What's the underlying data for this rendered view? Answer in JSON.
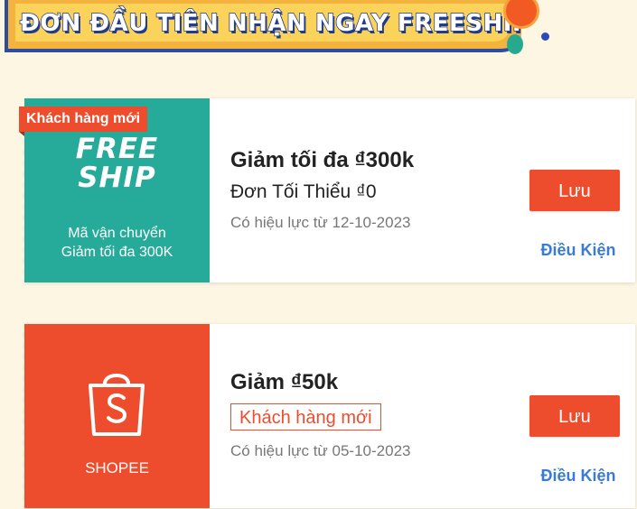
{
  "banner": {
    "title": "ĐƠN ĐẦU TIÊN NHẬN NGAY FREESHIP"
  },
  "vouchers": [
    {
      "type": "freeship",
      "badge": "Khách hàng mới",
      "logo_line1": "FREE",
      "logo_line2": "SHIP",
      "caption_line1": "Mã vận chuyển",
      "caption_line2": "Giảm tối đa 300K",
      "title": "Giảm tối đa ₫300k",
      "subtitle": "Đơn Tối Thiểu ₫0",
      "valid": "Có hiệu lực từ 12-10-2023",
      "save_label": "Lưu",
      "conditions_label": "Điều Kiện",
      "panel_color": "#26aa99"
    },
    {
      "type": "shopee",
      "caption": "SHOPEE",
      "title": "Giảm ₫50k",
      "tag": "Khách hàng mới",
      "valid": "Có hiệu lực từ 05-10-2023",
      "save_label": "Lưu",
      "conditions_label": "Điều Kiện",
      "panel_color": "#ee4d2d"
    }
  ],
  "icons": {
    "bag": "shopee-bag-icon"
  },
  "colors": {
    "accent": "#ee4d2d",
    "teal": "#26aa99",
    "link": "#3a7bd5",
    "banner": "#fcd35a"
  }
}
